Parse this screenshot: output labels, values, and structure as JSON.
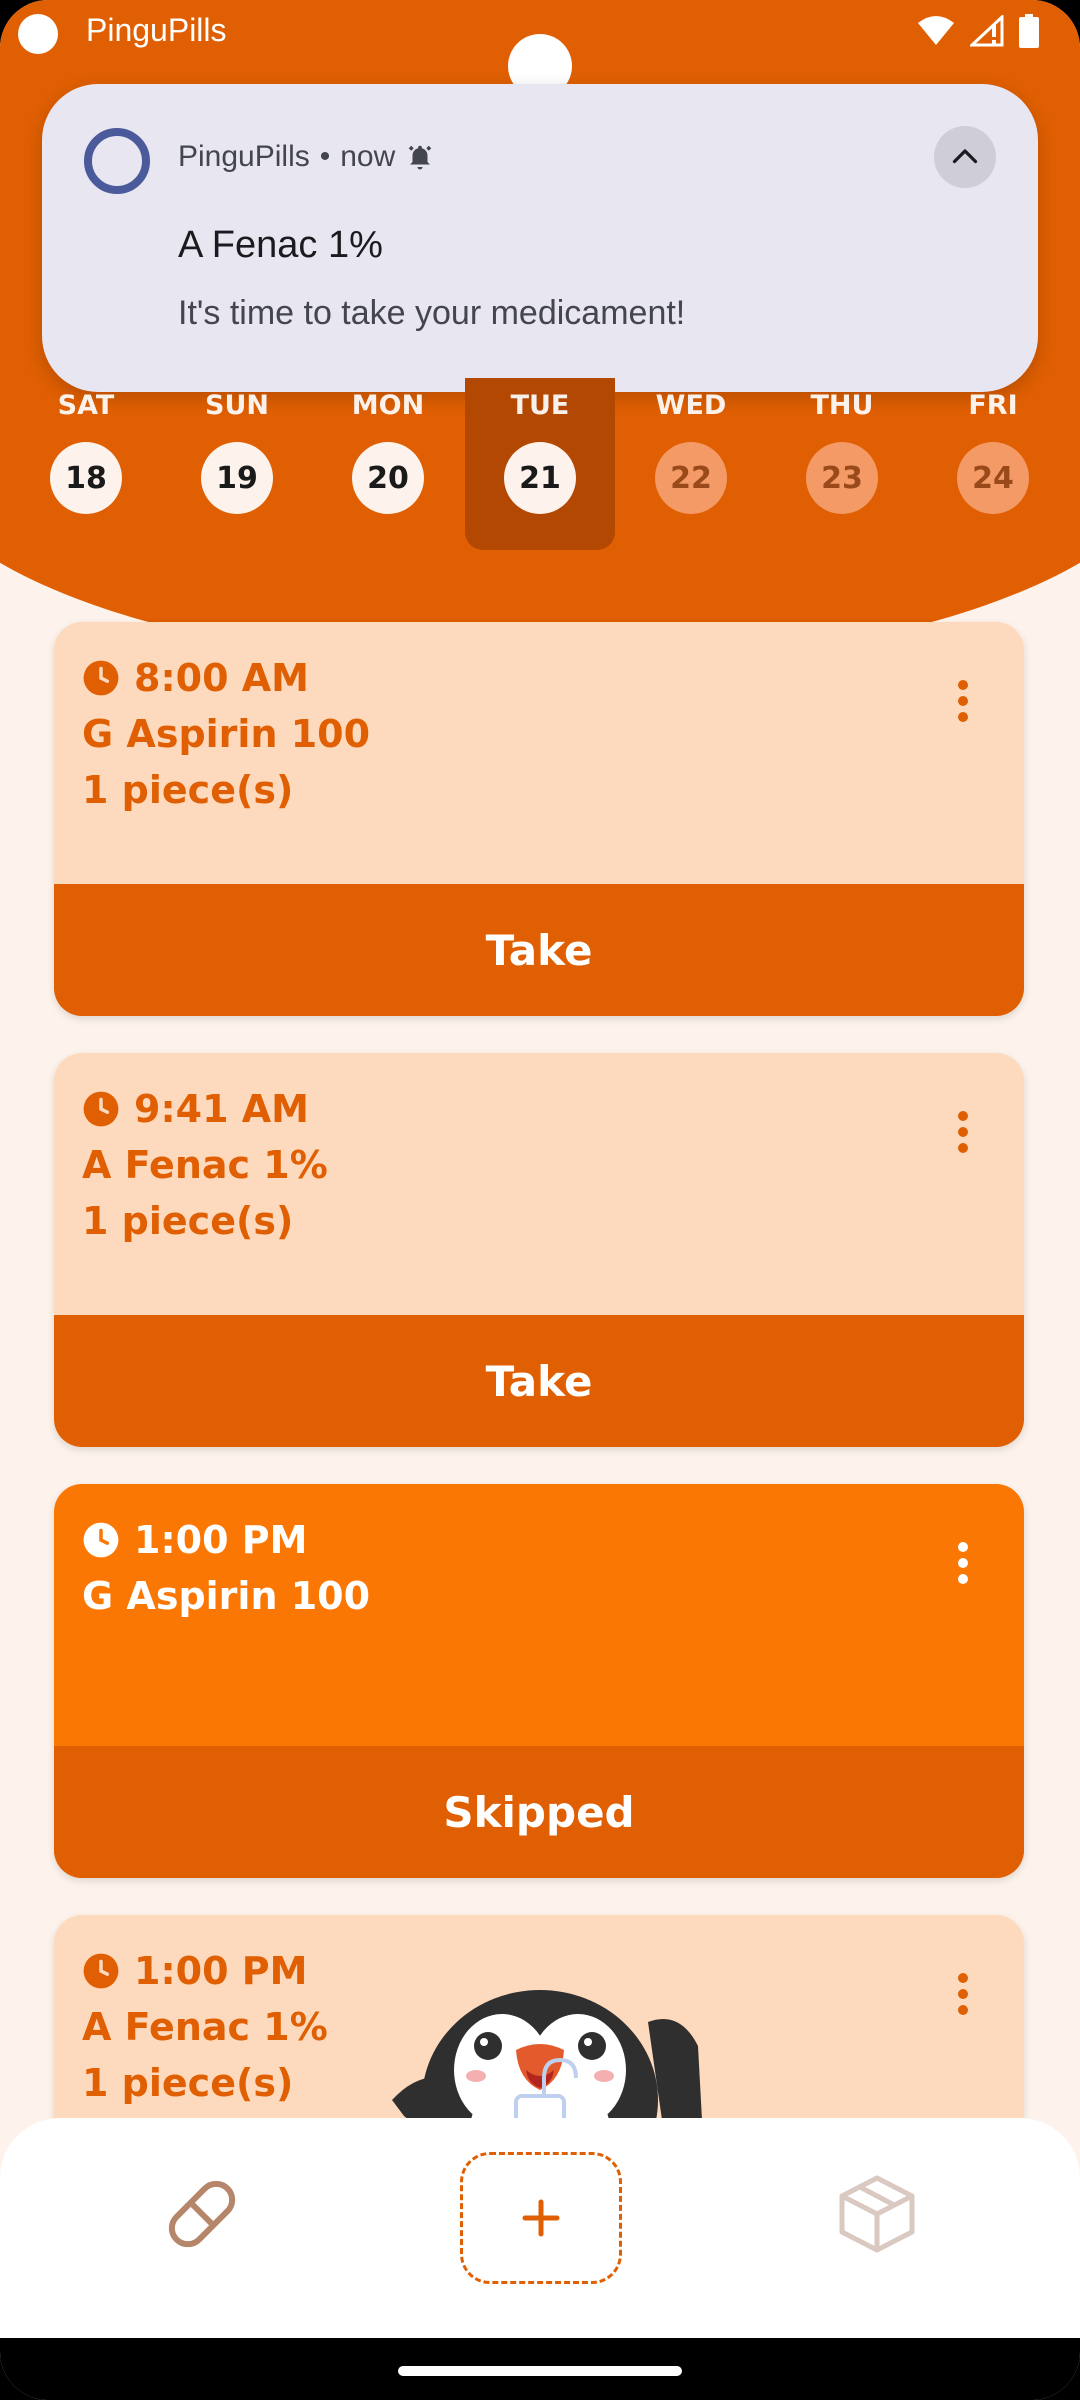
{
  "status_bar": {
    "app_name": "PinguPills"
  },
  "notification": {
    "app": "PinguPills",
    "separator": "•",
    "time": "now",
    "title": "A Fenac 1%",
    "body": "It's time to take your medicament!",
    "ring_color": "#4A5A9A"
  },
  "days": [
    {
      "name": "SAT",
      "num": "18",
      "state": "past"
    },
    {
      "name": "SUN",
      "num": "19",
      "state": "past"
    },
    {
      "name": "MON",
      "num": "20",
      "state": "past"
    },
    {
      "name": "TUE",
      "num": "21",
      "state": "selected"
    },
    {
      "name": "WED",
      "num": "22",
      "state": "future"
    },
    {
      "name": "THU",
      "num": "23",
      "state": "future"
    },
    {
      "name": "FRI",
      "num": "24",
      "state": "future"
    }
  ],
  "cards": [
    {
      "time": "8:00 AM",
      "name": "G Aspirin 100",
      "dose": "1 piece(s)",
      "action": "Take",
      "status": "pending"
    },
    {
      "time": "9:41 AM",
      "name": "A Fenac 1%",
      "dose": "1 piece(s)",
      "action": "Take",
      "status": "pending"
    },
    {
      "time": "1:00 PM",
      "name": "G Aspirin 100",
      "dose": "",
      "action": "Skipped",
      "status": "skipped"
    },
    {
      "time": "1:00 PM",
      "name": "A Fenac 1%",
      "dose": "1 piece(s)",
      "action": "",
      "status": "pending"
    }
  ],
  "colors": {
    "primary": "#E05F02",
    "selected_day": "#B24802",
    "card_bg": "#FDDABE",
    "skipped_card_bg": "#FB7703",
    "future_day": "#F39A66",
    "page_bg": "#FDF3EC"
  },
  "bottom_nav": {
    "items": [
      {
        "icon": "pill-icon"
      },
      {
        "icon": "plus-icon"
      },
      {
        "icon": "box-icon"
      }
    ]
  }
}
